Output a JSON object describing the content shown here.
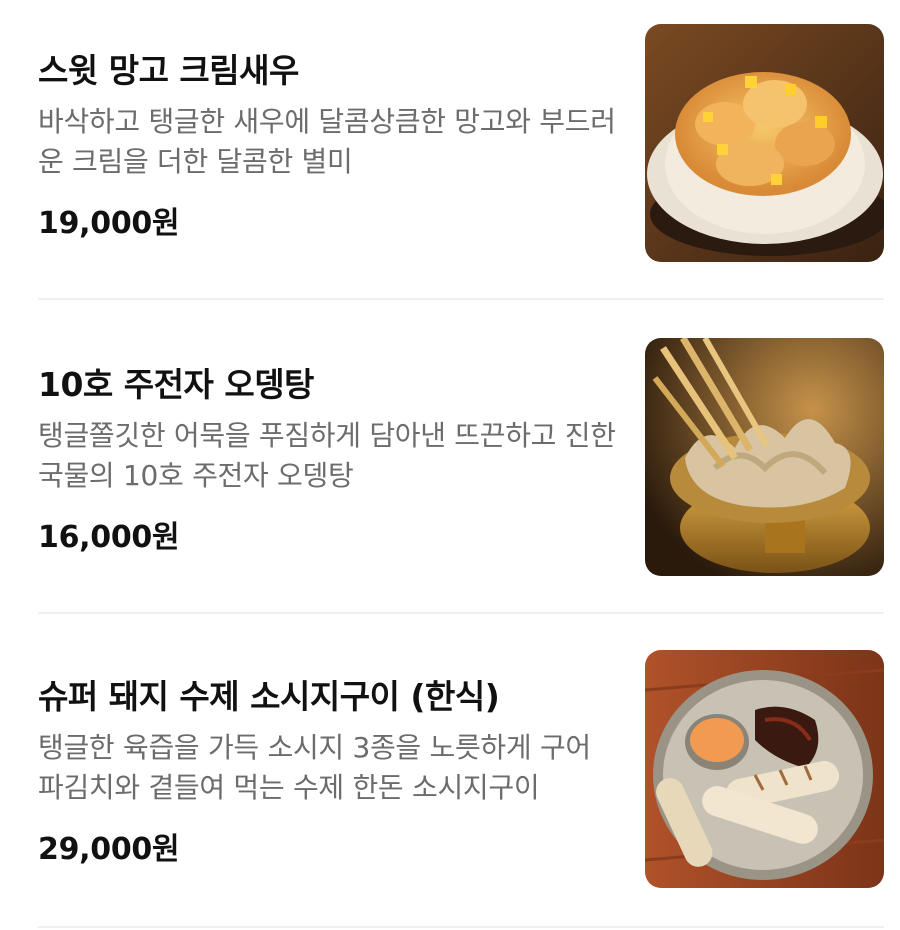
{
  "menu": {
    "items": [
      {
        "name": "스윗 망고 크림새우",
        "description": "바삭하고 탱글한 새우에 달콤상큼한 망고와 부드러운 크림을 더한 달콤한 별미",
        "price": "19,000원",
        "photo_icon": "shrimp-photo"
      },
      {
        "name": "10호 주전자 오뎅탕",
        "description": "탱글쫄깃한 어묵을 푸짐하게 담아낸 뜨끈하고 진한 국물의 10호 주전자 오뎅탕",
        "price": "16,000원",
        "photo_icon": "odeng-photo"
      },
      {
        "name": "슈퍼 돼지 수제 소시지구이 (한식)",
        "description": "탱글한 육즙을 가득 소시지 3종을 노릇하게 구어 파김치와 곁들여 먹는 수제 한돈 소시지구이",
        "price": "29,000원",
        "photo_icon": "sausage-photo"
      }
    ]
  }
}
